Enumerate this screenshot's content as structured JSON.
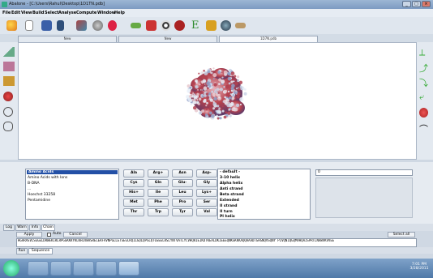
{
  "window": {
    "title": "Abalone - [C:\\Users\\Rahul\\Desktop\\1D1TN.pdb]",
    "controls": [
      "_",
      "□",
      "×"
    ]
  },
  "menu": [
    "File",
    "Edit",
    "View",
    "Build",
    "Select",
    "Analyse",
    "Compute",
    "Window",
    "Help"
  ],
  "tabs": [
    "New",
    "New",
    "1D7N.pdb"
  ],
  "fragments": {
    "items": [
      "Amino Acids",
      "Amino Acids with Ions",
      "B-DNA",
      "...",
      "Hoechst 33258",
      "Pentamidine"
    ],
    "selected_index": 0
  },
  "amino_acids": [
    [
      "Ala",
      "Arg+",
      "Asn",
      "Asp-"
    ],
    [
      "Cys",
      "Gln",
      "Glu-",
      "Gly"
    ],
    [
      "His+",
      "Ile",
      "Leu",
      "Lys+"
    ],
    [
      "Met",
      "Phe",
      "Pro",
      "Ser"
    ],
    [
      "Thr",
      "Trp",
      "Tyr",
      "Val"
    ]
  ],
  "secondary_structure": [
    "- default -",
    "3-10 helix",
    "Alpha helix",
    "Anti strand",
    "Beta strand",
    "Extended",
    "II strand",
    "II turn",
    "PI helix"
  ],
  "combo_value": "0",
  "log_tabs": [
    "Log",
    "Warn",
    "Info",
    "Chain"
  ],
  "seq_controls": {
    "apply": "Apply",
    "auto": "Auto",
    "cancel": "Cancel",
    "select_all": "Select all"
  },
  "sequence": "HGARASVLSGGELDRWEKIRLRPGGKKKYKLKHIVWASRELERFAVNPGLLETSEGCRQILGQLQPSLQTGSEELRSLYNTVATLYCVHQRIEIKDTKEALDKIEEEQNKSKKKAQQAAADTGHSNQVSQNY PIVQNIQGQMVHQAISPRTLNAWVKVVEE",
  "bottom_tabs": [
    "Run",
    "Sequence"
  ],
  "clock": {
    "time": "7:01 PM",
    "date": "3/28/2011"
  },
  "colors": {
    "selection": "#2350a6",
    "titlebar": "#8aa6c9",
    "taskbar": "#5b84b2"
  }
}
